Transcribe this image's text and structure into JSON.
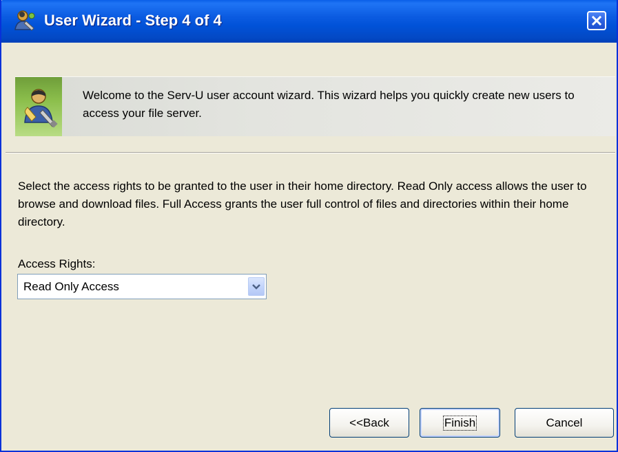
{
  "window": {
    "title": "User Wizard - Step 4 of 4",
    "close_icon": "close-icon",
    "title_icon": "wizard-users-icon"
  },
  "banner": {
    "icon": "user-account-wizard-icon",
    "text": "Welcome to the Serv-U user account wizard. This wizard helps you quickly create new users to access your file server."
  },
  "body": {
    "description": "Select the access rights to be granted to the user in their home directory. Read Only access allows the user to browse and download files. Full Access grants the user full control of files and directories within their home directory.",
    "access_rights_label": "Access Rights:",
    "access_rights_value": "Read Only Access"
  },
  "buttons": {
    "back_label": "<<Back",
    "finish_label": "Finish",
    "cancel_label": "Cancel"
  },
  "colors": {
    "titlebar": "#0152d8",
    "window_bg": "#ece9d8",
    "banner_accent": "#8cbf4c"
  }
}
